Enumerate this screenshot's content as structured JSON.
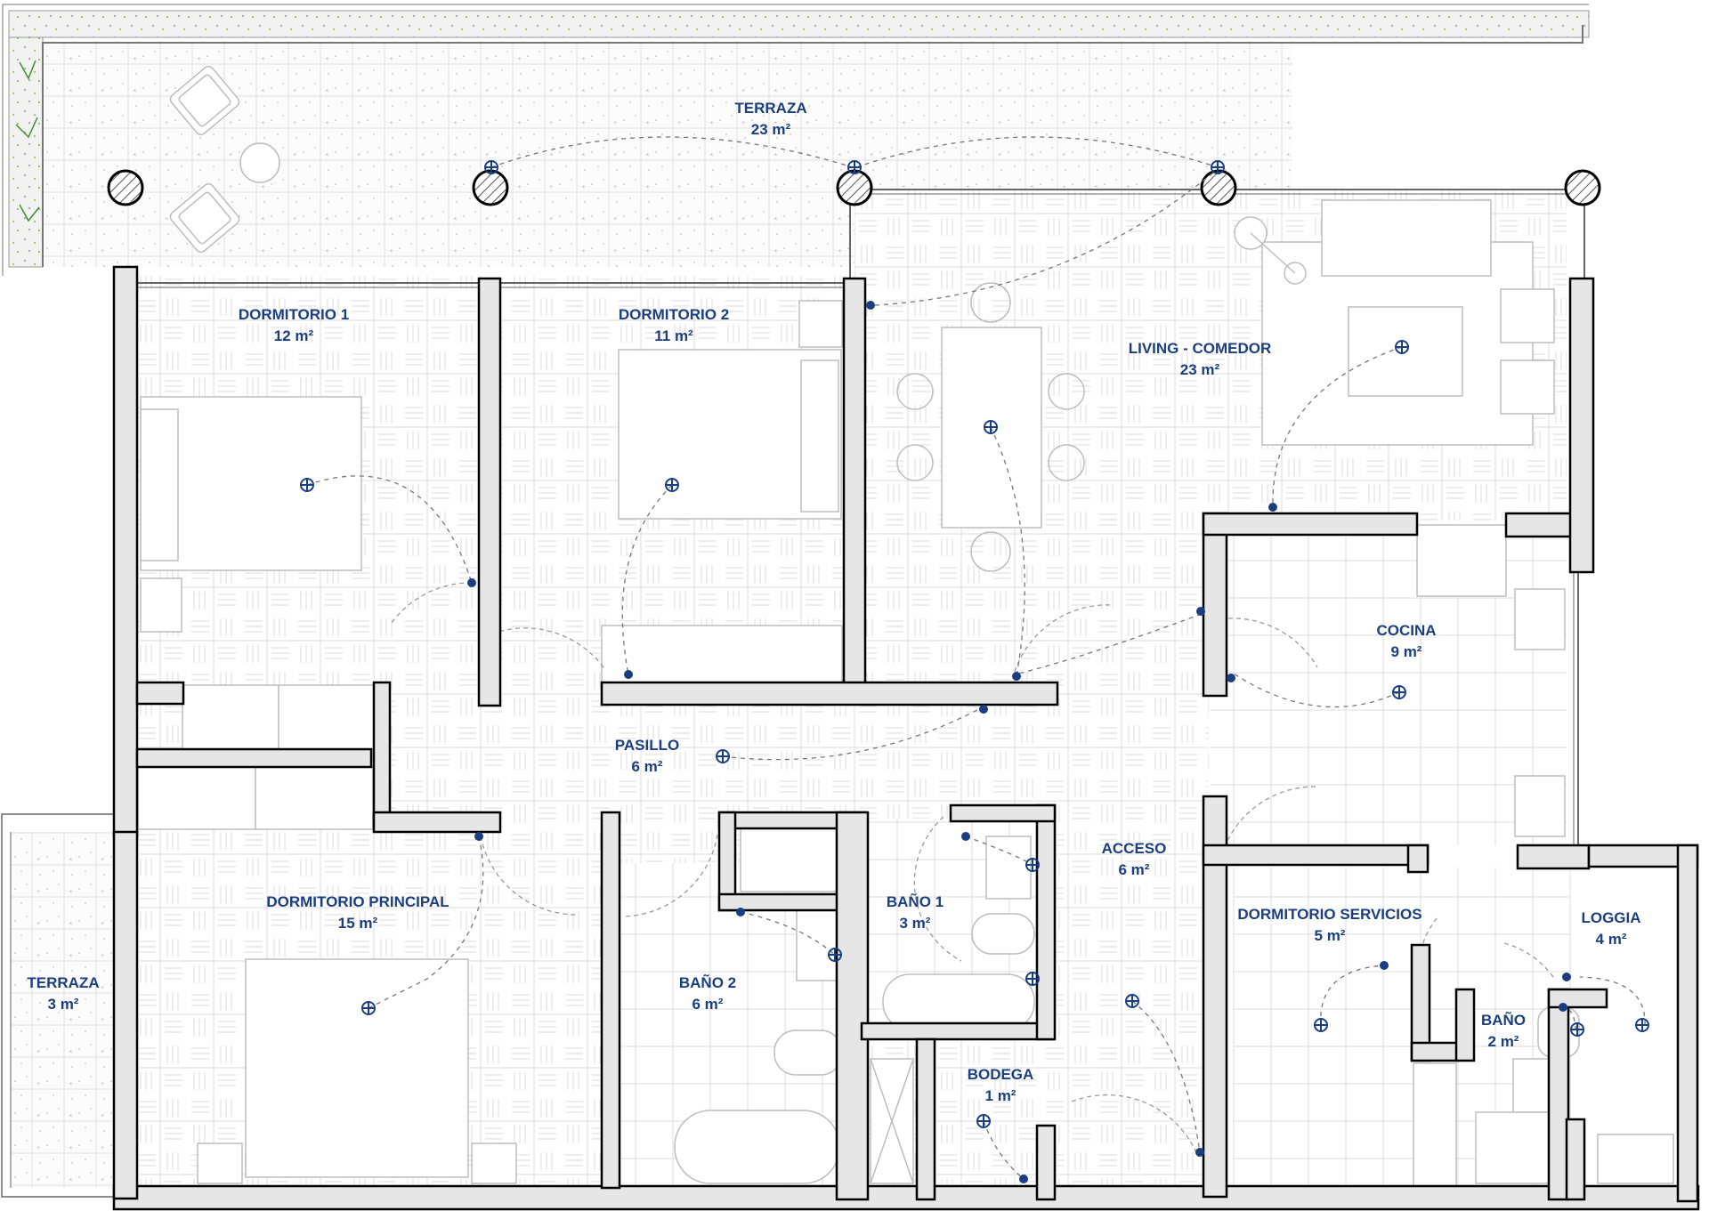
{
  "colors": {
    "wall_fill": "#e6e6e6",
    "wall_stroke": "#000000",
    "label": "#1b3e80",
    "fixture": "#1b3e80",
    "furniture": "#c8c8c8",
    "pattern": "#d9d9d9",
    "greenery": "#7fbf3f"
  },
  "rooms": [
    {
      "name": "TERRAZA",
      "area": "23 m²"
    },
    {
      "name": "DORMITORIO 1",
      "area": "12 m²"
    },
    {
      "name": "DORMITORIO 2",
      "area": "11 m²"
    },
    {
      "name": "LIVING - COMEDOR",
      "area": "23 m²"
    },
    {
      "name": "COCINA",
      "area": "9 m²"
    },
    {
      "name": "PASILLO",
      "area": "6 m²"
    },
    {
      "name": "ACCESO",
      "area": "6 m²"
    },
    {
      "name": "DORMITORIO PRINCIPAL",
      "area": "15 m²"
    },
    {
      "name": "BAÑO 1",
      "area": "3 m²"
    },
    {
      "name": "BAÑO 2",
      "area": "6 m²"
    },
    {
      "name": "BODEGA",
      "area": "1 m²"
    },
    {
      "name": "DORMITORIO SERVICIOS",
      "area": "5 m²"
    },
    {
      "name": "LOGGIA",
      "area": "4 m²"
    },
    {
      "name": "BAÑO",
      "area": "2 m²"
    },
    {
      "name": "TERRAZA",
      "area": "3 m²"
    }
  ]
}
